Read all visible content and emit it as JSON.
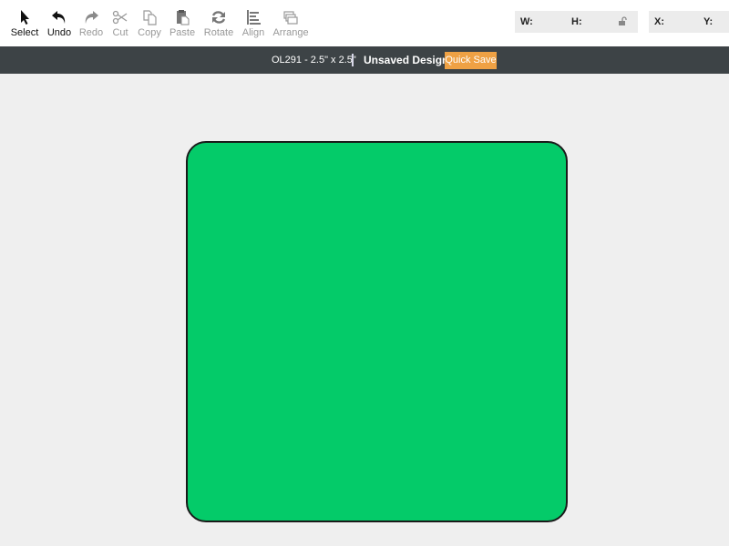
{
  "toolbar": {
    "tools": [
      {
        "label": "Select",
        "icon": "pointer-icon",
        "enabled": true
      },
      {
        "label": "Undo",
        "icon": "undo-icon",
        "enabled": true
      },
      {
        "label": "Redo",
        "icon": "redo-icon",
        "enabled": false
      },
      {
        "label": "Cut",
        "icon": "scissors-icon",
        "enabled": false
      },
      {
        "label": "Copy",
        "icon": "copy-icon",
        "enabled": false
      },
      {
        "label": "Paste",
        "icon": "paste-icon",
        "enabled": false
      },
      {
        "label": "Rotate",
        "icon": "rotate-icon",
        "enabled": false
      },
      {
        "label": "Align",
        "icon": "align-icon",
        "enabled": false
      },
      {
        "label": "Arrange",
        "icon": "arrange-icon",
        "enabled": false
      }
    ],
    "size_panel": {
      "w_label": "W:",
      "w_value": "",
      "h_label": "H:",
      "h_value": "",
      "lock_icon": "unlock-icon"
    },
    "position_panel": {
      "x_label": "X:",
      "x_value": "",
      "y_label": "Y:",
      "y_value": ""
    }
  },
  "titlebar": {
    "product": "OL291 - 2.5\" x 2.5\"",
    "design_title": "Unsaved Design",
    "quick_save": "Quick Save"
  },
  "canvas": {
    "shape": "rounded-square",
    "fill_color": "#04cb69",
    "stroke_color": "#1a1a1a"
  },
  "colors": {
    "titlebar_bg": "#3d4346",
    "quick_save_bg": "#efa144",
    "canvas_bg": "#efefef"
  }
}
